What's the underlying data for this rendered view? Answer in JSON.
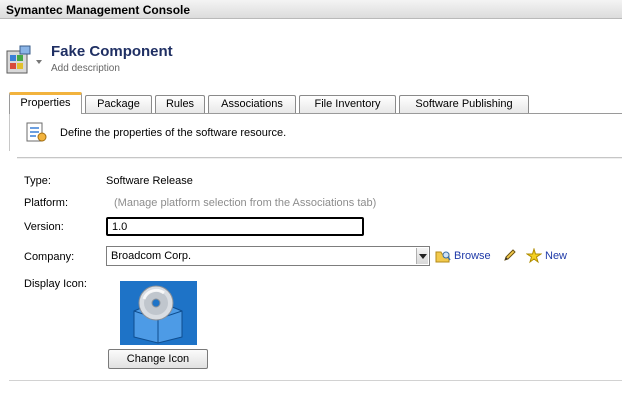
{
  "window": {
    "title": "Symantec Management Console"
  },
  "header": {
    "component_name": "Fake Component",
    "description_placeholder": "Add description"
  },
  "tabs": [
    {
      "label": "Properties",
      "active": true
    },
    {
      "label": "Package",
      "active": false
    },
    {
      "label": "Rules",
      "active": false
    },
    {
      "label": "Associations",
      "active": false
    },
    {
      "label": "File Inventory",
      "active": false
    },
    {
      "label": "Software Publishing",
      "active": false
    }
  ],
  "properties": {
    "intro": "Define the properties of the software resource.",
    "type_label": "Type:",
    "type_value": "Software Release",
    "platform_label": "Platform:",
    "platform_value": "(Manage platform selection from the Associations tab)",
    "version_label": "Version:",
    "version_value": "1.0",
    "company_label": "Company:",
    "company_value": "Broadcom Corp.",
    "browse_label": "Browse",
    "new_label": "New",
    "display_icon_label": "Display Icon:",
    "change_icon_label": "Change Icon"
  },
  "colors": {
    "title_text": "#1f2f63",
    "link": "#1f3aa8",
    "active_tab_accent": "#f2b33d",
    "muted_text": "#8d8d8d"
  },
  "icons": {
    "app": "software-package-icon",
    "properties": "properties-sheet-icon",
    "browse": "browse-folder-icon",
    "edit": "pencil-icon",
    "new": "new-star-icon",
    "display": "software-box-cd-icon"
  }
}
